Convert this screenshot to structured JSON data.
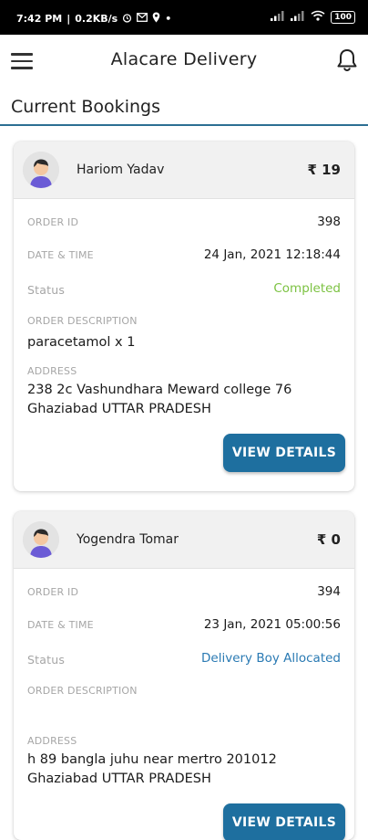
{
  "status_bar": {
    "time": "7:42 PM",
    "network_speed": "0.2KB/s",
    "battery": "100"
  },
  "app": {
    "title": "Alacare Delivery"
  },
  "section": {
    "title": "Current Bookings"
  },
  "labels": {
    "order_id": "ORDER ID",
    "date_time": "DATE & TIME",
    "status": "Status",
    "order_description": "ORDER DESCRIPTION",
    "address": "ADDRESS",
    "view_details": "VIEW DETAILS"
  },
  "bookings": [
    {
      "customer_name": "Hariom Yadav",
      "amount": "₹ 19",
      "order_id": "398",
      "date_time": "24 Jan, 2021 12:18:44",
      "status": "Completed",
      "description": "paracetamol x 1",
      "address_line1": "238 2c Vashundhara Meward college 76",
      "address_line2": "Ghaziabad UTTAR PRADESH"
    },
    {
      "customer_name": "Yogendra Tomar",
      "amount": "₹ 0",
      "order_id": "394",
      "date_time": "23 Jan, 2021 05:00:56",
      "status": "Delivery Boy Allocated",
      "description": "",
      "address_line1": "h 89 bangla juhu near mertro 201012",
      "address_line2": "Ghaziabad UTTAR PRADESH"
    }
  ],
  "colors": {
    "accent": "#1e6f9f",
    "section_rule": "#2c6f93",
    "status_completed": "#7cc242",
    "status_allocated": "#2a7ab3"
  }
}
